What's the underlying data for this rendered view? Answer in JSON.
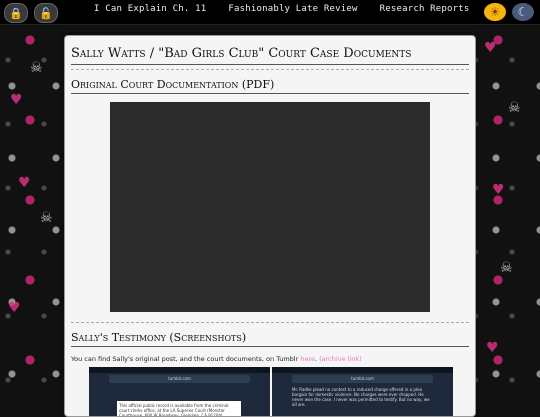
{
  "nav": {
    "items": [
      "I Can Explain Ch. 11",
      "Fashionably Late Review",
      "Research Reports"
    ]
  },
  "icons": {
    "lock_left": "lock-icon",
    "unlock": "unlock-icon",
    "sun": "sun-icon",
    "moon": "moon-icon"
  },
  "page": {
    "title": "Sally Watts / \"Bad Girls Club\" Court Case Documents",
    "section1": "Original Court Documentation (PDF)",
    "section2": "Sally's Testimony (Screenshots)",
    "note_prefix": "You can find Sally's original post, and the court documents, on Tumblr ",
    "link_here": "here",
    "note_mid": ". ",
    "link_archive": "(archive link)"
  },
  "screenshots": [
    {
      "url": "tumblr.com",
      "text": "This official public record is available from the criminal court clerks office, at the LA Superior Court (Monster Courthouse, 600 W Broadway, Glendale, CA 91204)."
    },
    {
      "url": "tumblr.com",
      "text": "Mr. Radke plead no contest to a reduced charge offered in a plea bargain for domestic violence. No charges were ever dropped. He never won the case. I never was permitted to testify. But no way, we all are."
    }
  ],
  "colors": {
    "accent_link": "#e879b9",
    "pdf_bg": "#2b2b2b",
    "page_bg": "#f5f5f5"
  }
}
